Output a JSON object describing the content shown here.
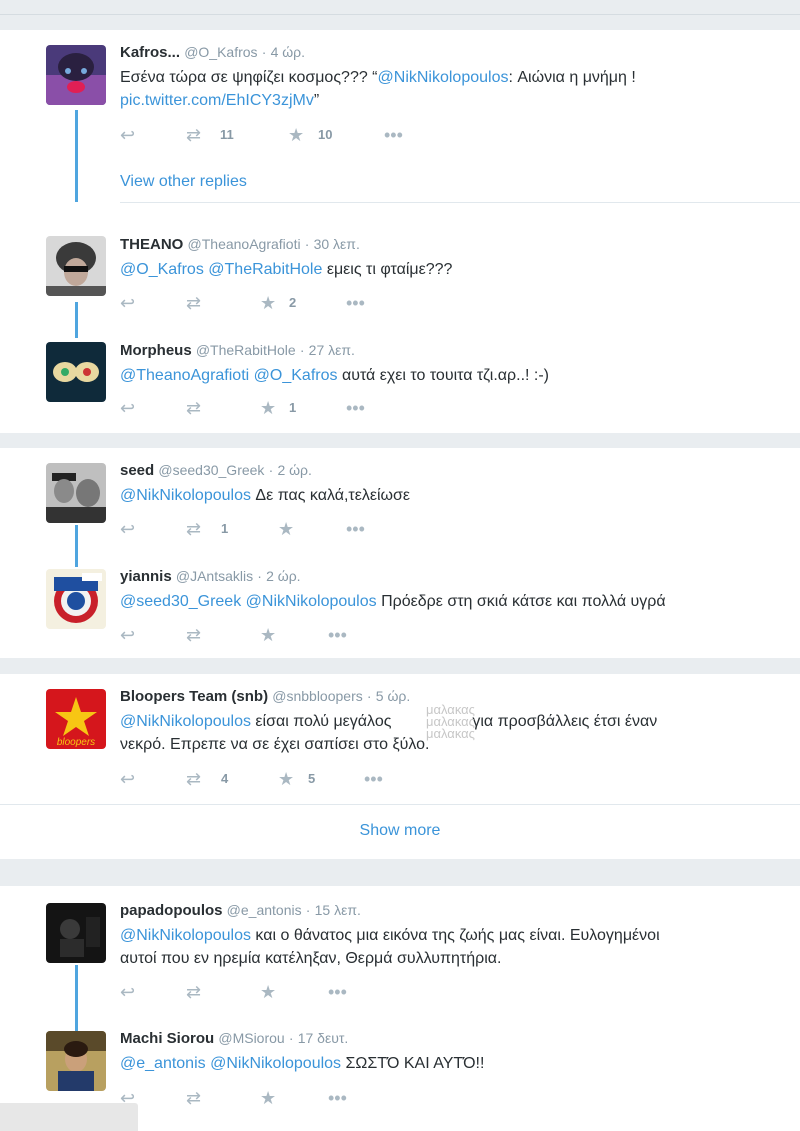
{
  "tweets": [
    {
      "name": "Kafros...",
      "handle": "@O_Kafros",
      "time": "4 ώρ.",
      "text_pre": "Εσένα τώρα σε ψηφίζει κοσμος??? “",
      "mention": "@NikNikolopoulos",
      "text_post": ": Αιώνια η μνήμη !",
      "pic": "pic.twitter.com/EhICY3zjMv",
      "text_end": "”",
      "retweets": "11",
      "likes": "10"
    },
    {
      "name": "THEANO",
      "handle": "@TheanoAgrafioti",
      "time": "30 λεπ.",
      "mention1": "@O_Kafros",
      "mention2": "@TheRabitHole",
      "text": "εμεις τι φταίμε???",
      "retweets": "",
      "likes": "2"
    },
    {
      "name": "Morpheus",
      "handle": "@TheRabitHole",
      "time": "27 λεπ.",
      "mention1": "@TheanoAgrafioti",
      "mention2": "@O_Kafros",
      "text": "αυτά εχει το τουιτα τζι.αρ..! :-)",
      "retweets": "",
      "likes": "1"
    },
    {
      "name": "seed",
      "handle": "@seed30_Greek",
      "time": "2 ώρ.",
      "mention1": "@NikNikolopoulos",
      "text": "Δε πας καλά,τελείωσε",
      "retweets": "1",
      "likes": ""
    },
    {
      "name": "yiannis",
      "handle": "@JAntsaklis",
      "time": "2 ώρ.",
      "mention1": "@seed30_Greek",
      "mention2": "@NikNikolopoulos",
      "text": "Πρόεδρε στη σκιά κάτσε και πολλά υγρά",
      "retweets": "",
      "likes": ""
    },
    {
      "name": "Bloopers Team (snb)",
      "handle": "@snbbloopers",
      "time": "5 ώρ.",
      "mention1": "@NikNikolopoulos",
      "text_a": "είσαι πολύ μεγάλος",
      "text_b": "για προσβάλλεις έτσι έναν",
      "line2": "νεκρό. Επρεπε να σε έχει σαπίσει στο ξύλο.",
      "retweets": "4",
      "likes": "5",
      "avatar_text": "bloopers"
    },
    {
      "name": "papadopoulos",
      "handle": "@e_antonis",
      "time": "15 λεπ.",
      "mention1": "@NikNikolopoulos",
      "text": "και ο θάνατος μια εικόνα της ζωής μας είναι. Ευλογημένοι",
      "line2": "αυτοί που εν ηρεμία κατέληξαν, Θερμά συλλυπητήρια.",
      "retweets": "",
      "likes": ""
    },
    {
      "name": "Machi Siorou",
      "handle": "@MSiorou",
      "time": "17 δευτ.",
      "mention1": "@e_antonis",
      "mention2": "@NikNikolopoulos",
      "text": "ΣΩΣΤΌ ΚΑΙ ΑΥΤΌ!!",
      "retweets": "",
      "likes": ""
    }
  ],
  "view_other_replies": "View other replies",
  "show_more": "Show more",
  "watermark": [
    "μαλακας",
    "μαλακας",
    "μαλακας"
  ],
  "colors": {
    "link": "#3b94d9",
    "thread": "#4fa5df",
    "icon": "#aab8c2"
  },
  "icons": {
    "reply": "reply-icon",
    "retweet": "retweet-icon",
    "like": "star-icon",
    "more": "more-icon"
  }
}
